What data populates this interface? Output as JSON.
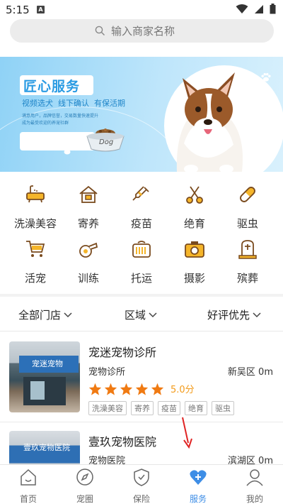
{
  "status_bar": {
    "time": "5:15",
    "notification_badge": "A"
  },
  "search": {
    "placeholder": "输入商家名称"
  },
  "banner": {
    "headline": "匠心服务",
    "subheadline": "视频选犬  线下确认  有保活期",
    "tagline_1": "满意用户，品牌信誉，交易数量快速提升",
    "tagline_2": "成为最受欢迎的养宠社群",
    "bowl_label": "Dog"
  },
  "categories": [
    {
      "label": "洗澡美容",
      "icon": "bathtub-icon"
    },
    {
      "label": "寄养",
      "icon": "house-icon"
    },
    {
      "label": "疫苗",
      "icon": "syringe-icon"
    },
    {
      "label": "绝育",
      "icon": "scissors-icon"
    },
    {
      "label": "驱虫",
      "icon": "pill-icon"
    },
    {
      "label": "活宠",
      "icon": "cart-icon"
    },
    {
      "label": "训练",
      "icon": "whistle-icon"
    },
    {
      "label": "托运",
      "icon": "pet-carrier-icon"
    },
    {
      "label": "摄影",
      "icon": "camera-icon"
    },
    {
      "label": "殡葬",
      "icon": "tombstone-icon"
    }
  ],
  "filters": [
    {
      "label": "全部门店"
    },
    {
      "label": "区域"
    },
    {
      "label": "好评优先"
    }
  ],
  "stores": [
    {
      "name": "宠迷宠物诊所",
      "type": "宠物诊所",
      "distance": "新吴区 0m",
      "stars": 5,
      "score": "5.0分",
      "tags": [
        "洗澡美容",
        "寄养",
        "疫苗",
        "绝育",
        "驱虫"
      ],
      "sign_text": "宠迷宠物"
    },
    {
      "name": "壹玖宠物医院",
      "type": "宠物医院",
      "distance": "滨湖区 0m",
      "sign_text": "壹玖宠物医院"
    }
  ],
  "tabs": [
    {
      "label": "首页",
      "icon": "home-icon"
    },
    {
      "label": "宠圈",
      "icon": "compass-icon"
    },
    {
      "label": "保险",
      "icon": "shield-icon"
    },
    {
      "label": "服务",
      "icon": "heart-plus-icon",
      "active": true
    },
    {
      "label": "我的",
      "icon": "profile-icon"
    }
  ],
  "colors": {
    "accent": "#3e8ee6",
    "icon_brown": "#7a4b1e",
    "icon_gold": "#f5b52a",
    "star": "#f07a12",
    "banner_blue": "#2a9be3",
    "arrow_red": "#e02424"
  }
}
